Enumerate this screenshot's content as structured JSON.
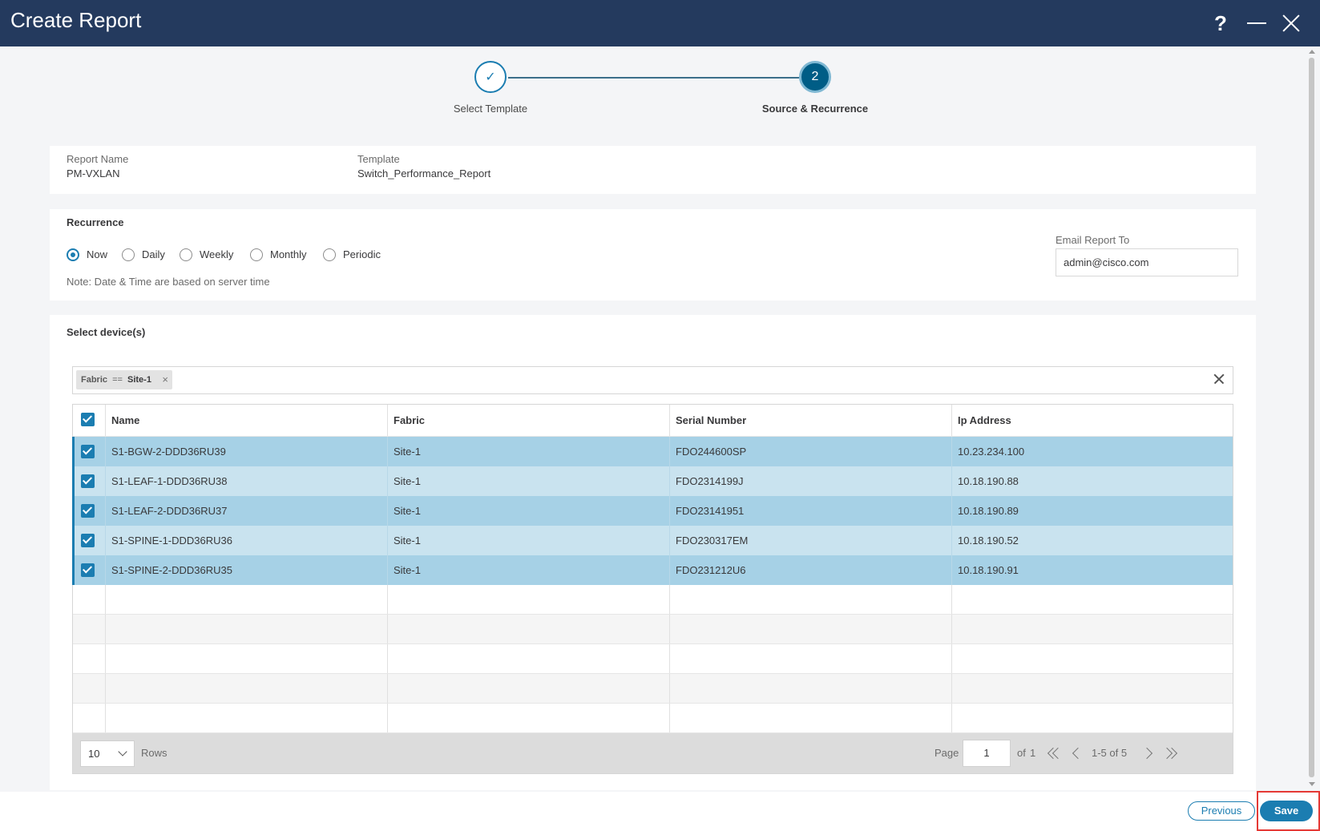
{
  "window": {
    "title": "Create Report",
    "help_label": "?"
  },
  "wizard": {
    "steps": [
      {
        "label": "Select Template",
        "marker": "✓",
        "state": "completed"
      },
      {
        "label": "Source & Recurrence",
        "marker": "2",
        "state": "active"
      }
    ]
  },
  "report_info": {
    "report_name_label": "Report Name",
    "report_name": "PM-VXLAN",
    "template_label": "Template",
    "template": "Switch_Performance_Report"
  },
  "recurrence": {
    "title": "Recurrence",
    "options": [
      "Now",
      "Daily",
      "Weekly",
      "Monthly",
      "Periodic"
    ],
    "selected": "Now",
    "note": "Note: Date & Time are based on server time",
    "email_label": "Email Report To",
    "email_value": "admin@cisco.com"
  },
  "devices": {
    "title": "Select device(s)",
    "filter": {
      "key": "Fabric",
      "op": "==",
      "value": "Site-1",
      "remove_glyph": "×"
    },
    "columns": [
      "Name",
      "Fabric",
      "Serial Number",
      "Ip Address"
    ],
    "rows": [
      {
        "name": "S1-BGW-2-DDD36RU39",
        "fabric": "Site-1",
        "serial": "FDO244600SP",
        "ip": "10.23.234.100"
      },
      {
        "name": "S1-LEAF-1-DDD36RU38",
        "fabric": "Site-1",
        "serial": "FDO2314199J",
        "ip": "10.18.190.88"
      },
      {
        "name": "S1-LEAF-2-DDD36RU37",
        "fabric": "Site-1",
        "serial": "FDO23141951",
        "ip": "10.18.190.89"
      },
      {
        "name": "S1-SPINE-1-DDD36RU36",
        "fabric": "Site-1",
        "serial": "FDO230317EM",
        "ip": "10.18.190.52"
      },
      {
        "name": "S1-SPINE-2-DDD36RU35",
        "fabric": "Site-1",
        "serial": "FDO231212U6",
        "ip": "10.18.190.91"
      }
    ],
    "pagination": {
      "rows_per_page": "10",
      "rows_label": "Rows",
      "page_label": "Page",
      "page": "1",
      "of_label": "of",
      "total_pages": "1",
      "range_text": "1-5 of 5"
    }
  },
  "footer": {
    "previous_label": "Previous",
    "save_label": "Save"
  },
  "colors": {
    "header_bg": "#243a5e",
    "accent": "#1b7db1",
    "selected_row": "#a6d1e6",
    "selected_row_alt": "#c9e3ef",
    "highlight_box": "#e53935"
  },
  "icons": {
    "help": "help-icon",
    "minimize": "minimize-icon",
    "close": "close-icon",
    "step_done": "check-icon",
    "clear_filter": "clear-filter-icon",
    "first_page": "first-page-icon",
    "prev_page": "prev-page-icon",
    "next_page": "next-page-icon",
    "last_page": "last-page-icon"
  }
}
